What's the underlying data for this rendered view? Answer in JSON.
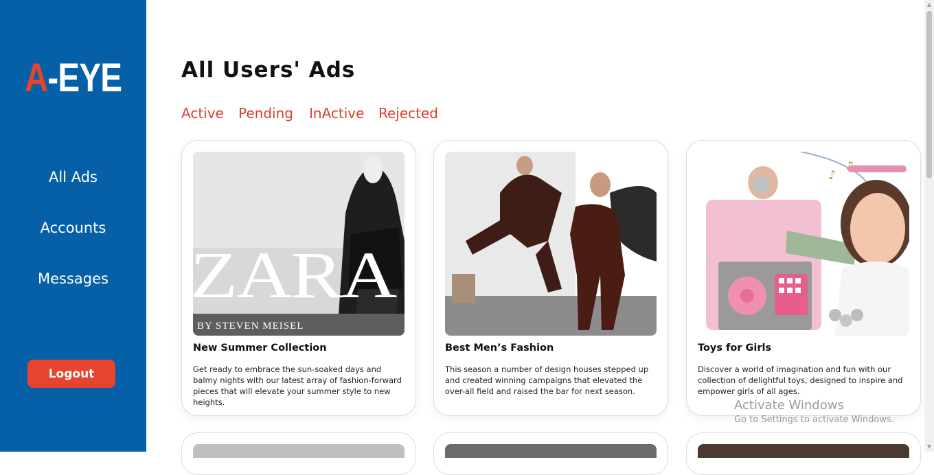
{
  "sidebar": {
    "logo": {
      "accent": "A",
      "rest": "-EYE"
    },
    "items": [
      {
        "label": "All Ads"
      },
      {
        "label": "Accounts"
      },
      {
        "label": "Messages"
      }
    ],
    "logout_label": "Logout"
  },
  "main": {
    "title": "All Users' Ads",
    "tabs": [
      {
        "label": "Active"
      },
      {
        "label": "Pending"
      },
      {
        "label": "InActive"
      },
      {
        "label": "Rejected"
      }
    ],
    "cards": [
      {
        "title": "New Summer Collection",
        "description": "Get ready to embrace the sun-soaked days and balmy nights with our latest array of fashion-forward pieces that will elevate your summer style to new heights.",
        "image_brand": "ZARA",
        "image_caption": "BY STEVEN MEISEL"
      },
      {
        "title": "Best Men’s Fashion",
        "description": "This season a number of design houses stepped up and created winning campaigns that elevated the over-all field and raised the bar for next season."
      },
      {
        "title": "Toys for Girls",
        "description": "Discover a world of imagination and fun with our collection of delightful toys, designed to inspire and empower girls of all ages."
      }
    ]
  },
  "watermark": {
    "line1": "Activate Windows",
    "line2": "Go to Settings to activate Windows."
  },
  "colors": {
    "sidebar_bg": "#0560a8",
    "accent": "#e8432c",
    "tab_text": "#d9402c"
  }
}
